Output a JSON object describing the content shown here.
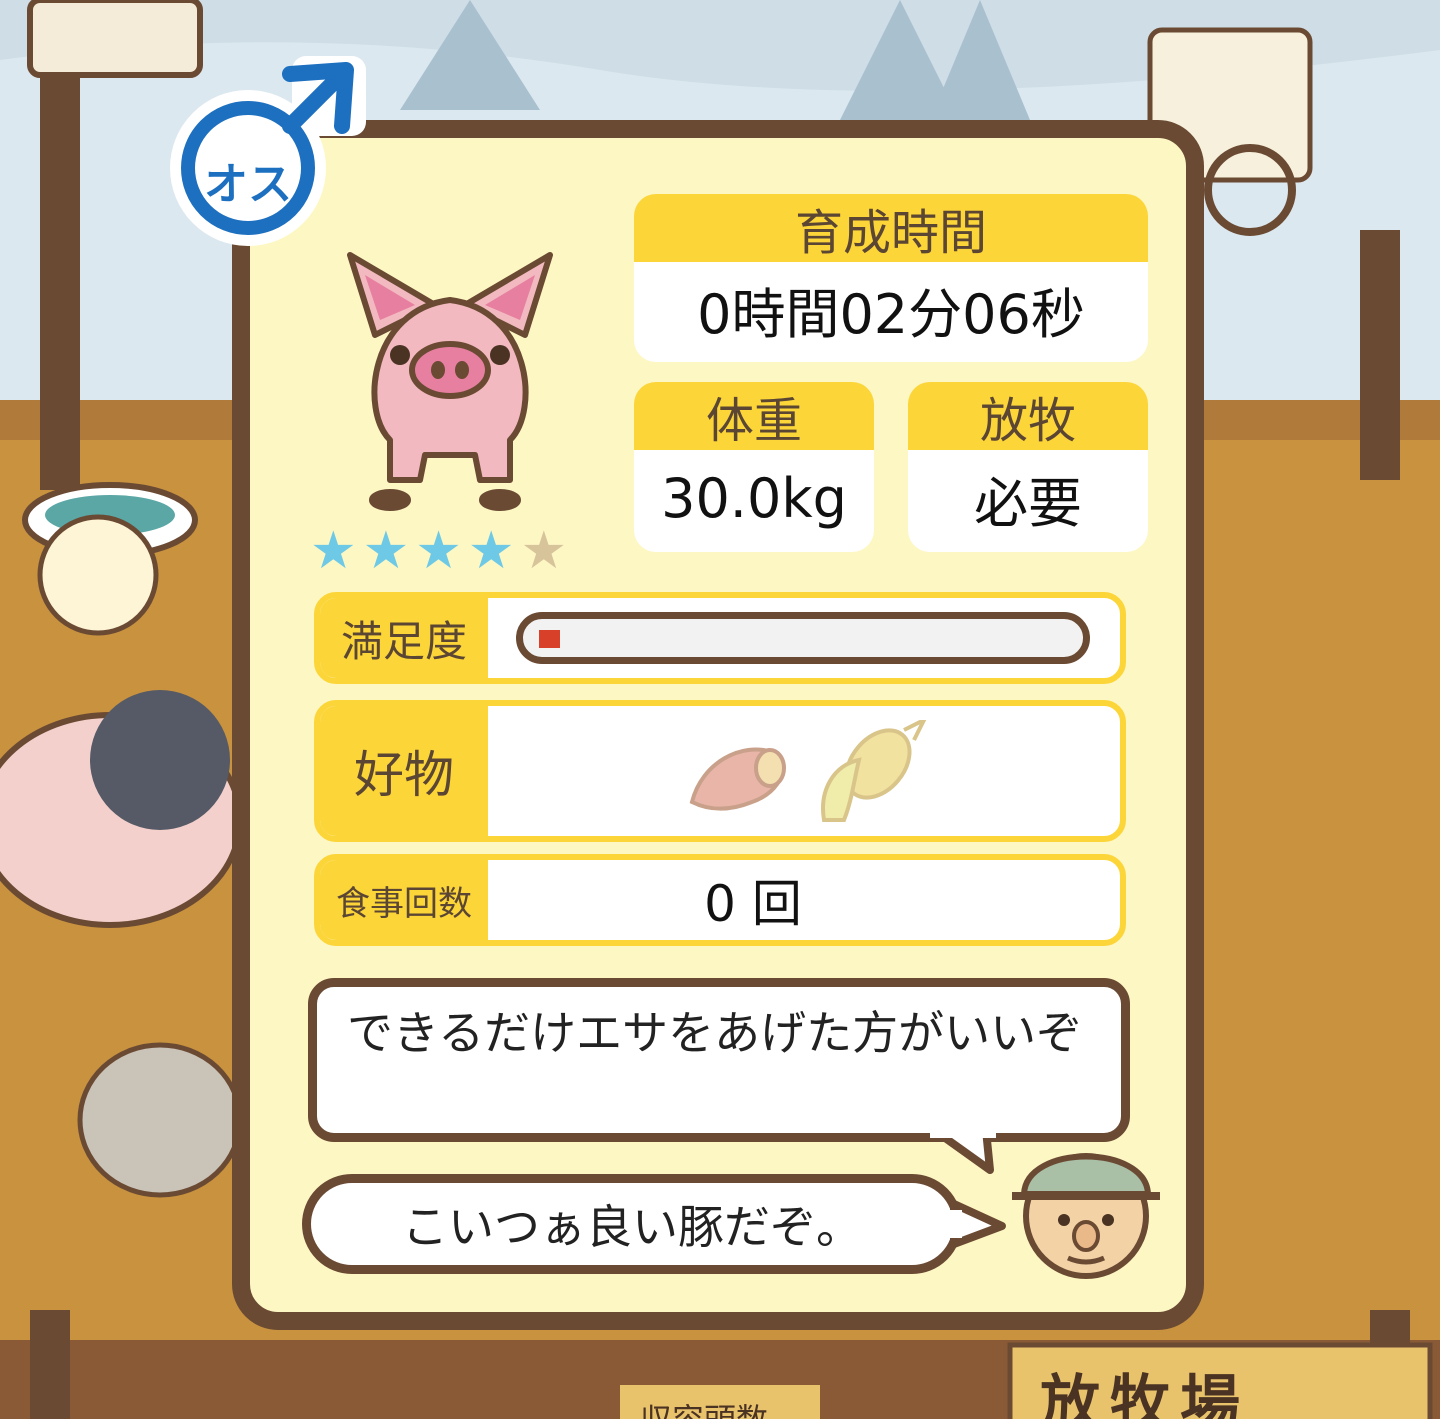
{
  "gender_badge": {
    "label": "オス",
    "icon": "male-symbol-icon"
  },
  "pig": {
    "icon": "pink-pig-icon",
    "rating": 4,
    "rating_max": 5
  },
  "stats": {
    "raising_time": {
      "label": "育成時間",
      "value": "0時間02分06秒"
    },
    "weight": {
      "label": "体重",
      "value": "30.0kg"
    },
    "grazing": {
      "label": "放牧",
      "value": "必要"
    }
  },
  "satisfaction": {
    "label": "満足度",
    "level": 0.04
  },
  "favorites": {
    "label": "好物",
    "items": [
      "sweet-potato-icon",
      "corn-icon"
    ]
  },
  "meal_count": {
    "label": "食事回数",
    "value": "0 回"
  },
  "farmer": {
    "advice": "できるだけエサをあげた方がいいぞ",
    "comment": "こいつぁ良い豚だぞ。",
    "icon": "farmer-face-icon"
  },
  "background": {
    "sign": "放牧場",
    "bottom_tab": "収容頭数"
  },
  "colors": {
    "frame": "#6b4a33",
    "panel": "#fdf7c4",
    "label": "#fcd539",
    "star_on": "#6ec9e6",
    "star_off": "#d8c49a",
    "bar_fill": "#d8402a"
  }
}
